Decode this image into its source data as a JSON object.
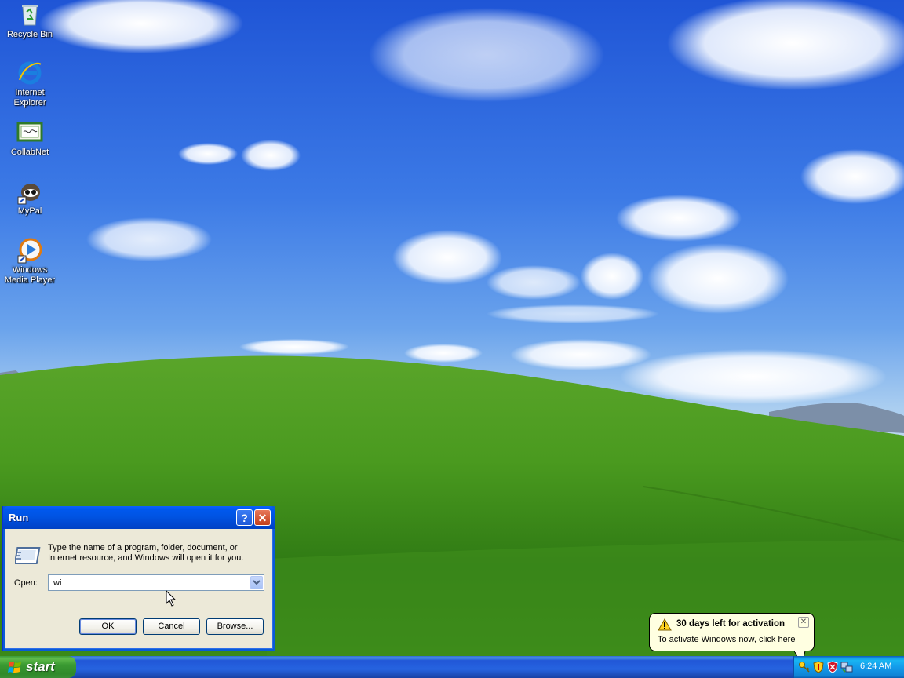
{
  "desktop": {
    "icons": [
      {
        "label": "Recycle Bin",
        "icon": "recycle-bin-icon"
      },
      {
        "label": "Internet Explorer",
        "line1": "Internet",
        "line2": "Explorer",
        "icon": "internet-explorer-icon"
      },
      {
        "label": "CollabNet",
        "icon": "collabnet-icon"
      },
      {
        "label": "MyPal",
        "icon": "mypal-icon"
      },
      {
        "label": "Windows Media Player",
        "line1": "Windows",
        "line2": "Media Player",
        "icon": "windows-media-player-icon"
      }
    ]
  },
  "run_dialog": {
    "title": "Run",
    "help_label": "?",
    "close_label": "✕",
    "description": "Type the name of a program, folder, document, or Internet resource, and Windows will open it for you.",
    "open_label": "Open:",
    "open_value": "wi",
    "buttons": {
      "ok": "OK",
      "cancel": "Cancel",
      "browse": "Browse..."
    }
  },
  "balloon": {
    "title": "30 days left for activation",
    "text": "To activate Windows now, click here",
    "close_label": "✕"
  },
  "taskbar": {
    "start_label": "start",
    "tray_icons": [
      "activation-key-icon",
      "security-shield-icon",
      "antivirus-icon",
      "network-icon"
    ],
    "clock": "6:24 AM"
  },
  "colors": {
    "title_bar": "#0054e3",
    "dialog_bg": "#ece9d8",
    "start_green": "#3a9a32",
    "taskbar_blue": "#2663e0",
    "tray_blue": "#139beb",
    "balloon_bg": "#ffffe1"
  }
}
